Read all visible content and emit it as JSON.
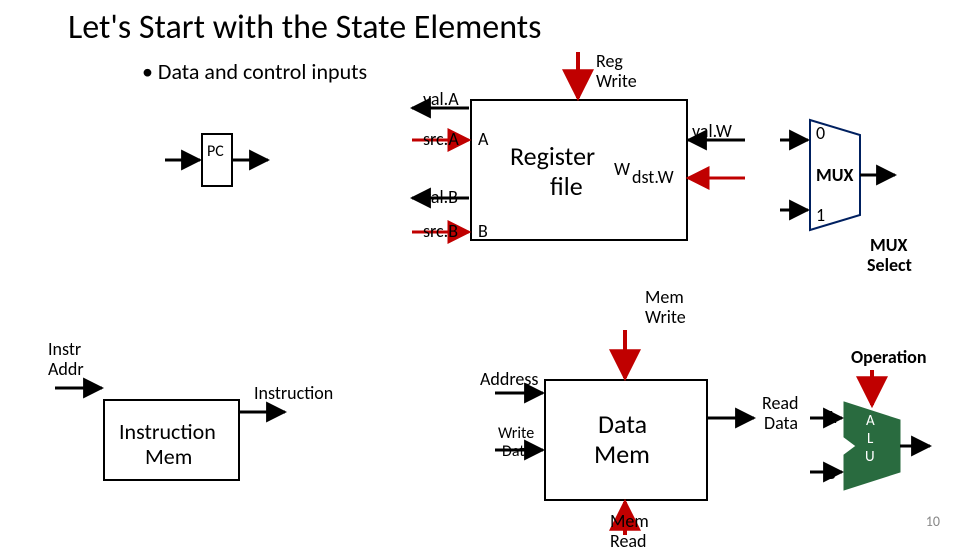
{
  "title": "Let's Start with the State Elements",
  "bullet": "• Data and control inputs",
  "labels": {
    "regwrite1": "Reg",
    "regwrite2": "Write",
    "valA": "val.A",
    "srcA": "src.A",
    "valB": "val.B",
    "srcB": "src.B",
    "A": "A",
    "B": "B",
    "W": "W",
    "valW": "val.W",
    "dstW": "dst.W",
    "regfile1": "Register",
    "regfile2": "file",
    "pc": "PC",
    "mux0": "0",
    "mux": "MUX",
    "mux1": "1",
    "muxsel1": "MUX",
    "muxsel2": "Select",
    "memwrite1": "Mem",
    "memwrite2": "Write",
    "instraddr1": "Instr",
    "instraddr2": "Addr",
    "instruction": "Instruction",
    "instrmem1": "Instruction",
    "instrmem2": "Mem",
    "address": "Address",
    "writedata1": "Write",
    "writedata2": "Data",
    "datamem1": "Data",
    "datamem2": "Mem",
    "readdata1": "Read",
    "readdata2": "Data",
    "operation": "Operation",
    "aluA": "A",
    "aluB": "B",
    "aluA2": "A",
    "aluL": "L",
    "aluU": "U",
    "memread1": "Mem",
    "memread2": "Read"
  },
  "page": "10"
}
